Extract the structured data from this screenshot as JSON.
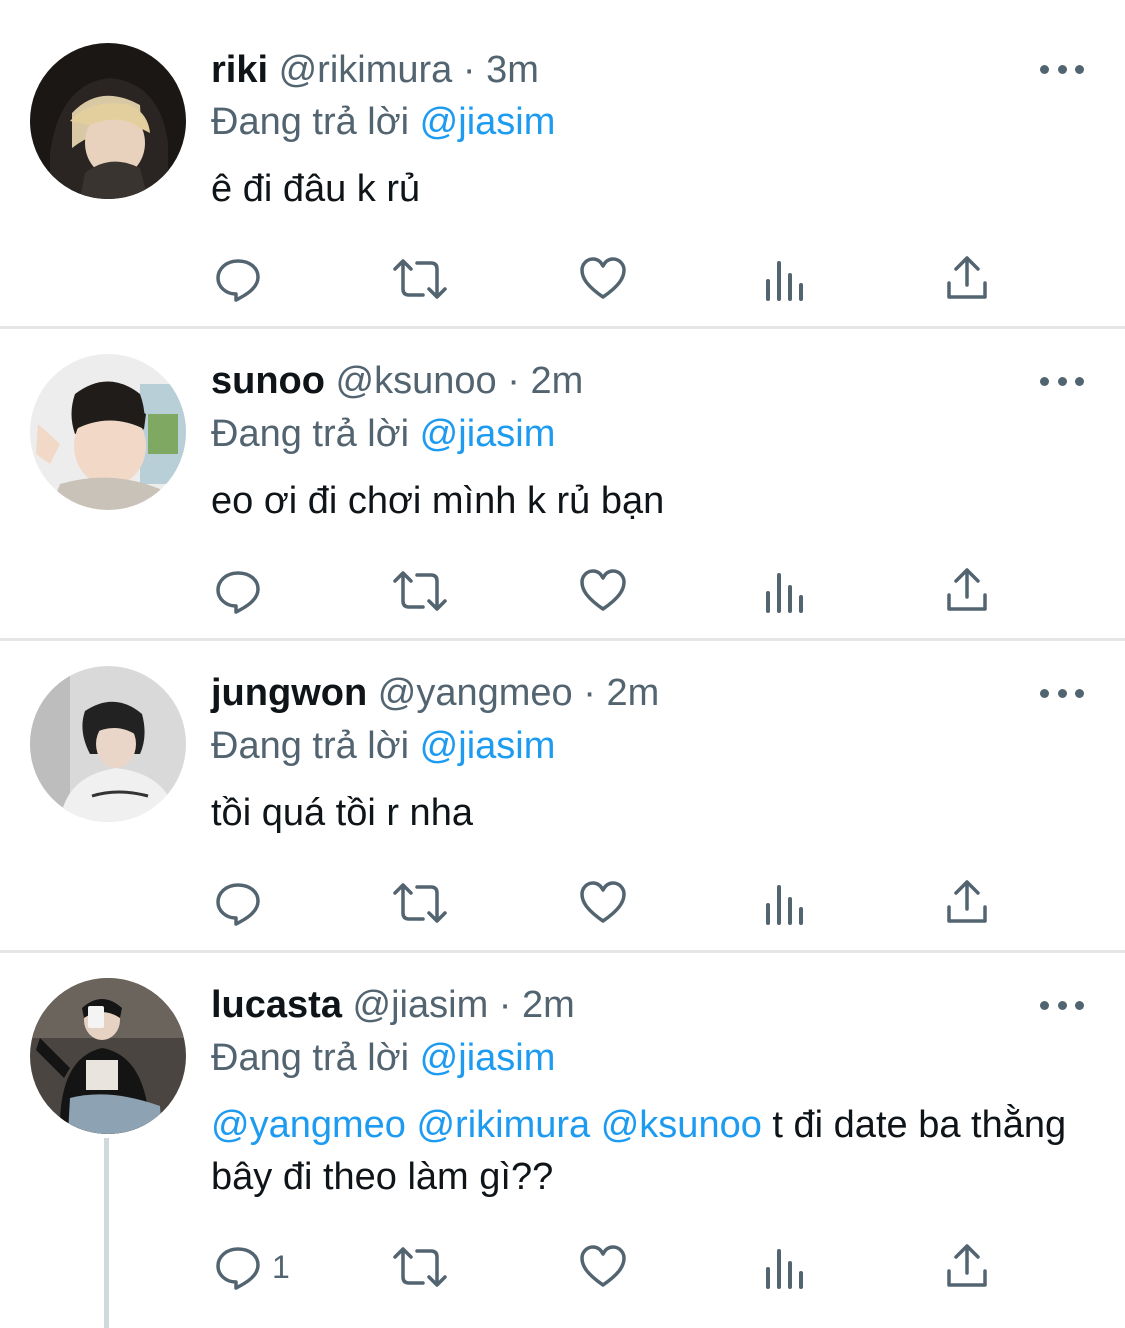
{
  "colors": {
    "accent": "#1d9bf0",
    "text": "#0f1419",
    "secondary": "#536471",
    "divider": "#e6e6e6"
  },
  "tweets": [
    {
      "name": "riki",
      "handle": "@rikimura",
      "sep": "·",
      "time": "3m",
      "replying_prefix": "Đang trả lời",
      "replying_to": "@jiasim",
      "text": "ê đi đâu k rủ",
      "reply_count": ""
    },
    {
      "name": "sunoo",
      "handle": "@ksunoo",
      "sep": "·",
      "time": "2m",
      "replying_prefix": "Đang trả lời",
      "replying_to": "@jiasim",
      "text": "eo ơi đi chơi mình k rủ bạn",
      "reply_count": ""
    },
    {
      "name": "jungwon",
      "handle": "@yangmeo",
      "sep": "·",
      "time": "2m",
      "replying_prefix": "Đang trả lời",
      "replying_to": "@jiasim",
      "text": "tồi quá tồi r nha",
      "reply_count": ""
    },
    {
      "name": "lucasta",
      "handle": "@jiasim",
      "sep": "·",
      "time": "2m",
      "replying_prefix": "Đang trả lời",
      "replying_to": "@jiasim",
      "mentions": [
        "@yangmeo",
        "@rikimura",
        "@ksunoo"
      ],
      "text": "t đi date ba thằng bây đi theo làm gì??",
      "reply_count": "1"
    }
  ],
  "icons": {
    "reply": "reply-icon",
    "retweet": "retweet-icon",
    "like": "heart-icon",
    "analytics": "analytics-icon",
    "share": "share-icon",
    "more": "more-icon"
  }
}
